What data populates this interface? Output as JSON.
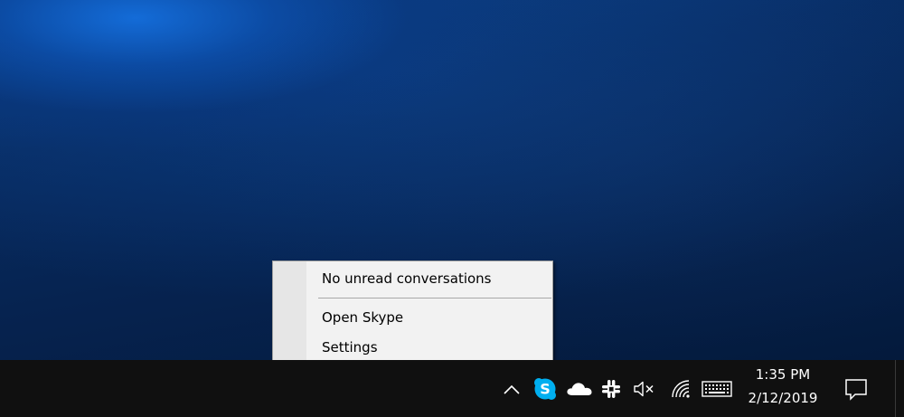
{
  "context_menu": {
    "items": [
      {
        "label": "No unread conversations"
      },
      {
        "label": "Open Skype"
      },
      {
        "label": "Settings"
      }
    ]
  },
  "taskbar": {
    "background": "#101010",
    "tray_icons": [
      {
        "name": "chevron-up-icon"
      },
      {
        "name": "skype-icon",
        "glyph": "S",
        "color": "#00aff0"
      },
      {
        "name": "onedrive-icon"
      },
      {
        "name": "slack-icon"
      },
      {
        "name": "volume-muted-icon"
      },
      {
        "name": "wifi-icon"
      },
      {
        "name": "keyboard-icon"
      },
      {
        "name": "action-center-icon"
      }
    ],
    "clock": {
      "time": "1:35 PM",
      "date": "2/12/2019"
    }
  }
}
